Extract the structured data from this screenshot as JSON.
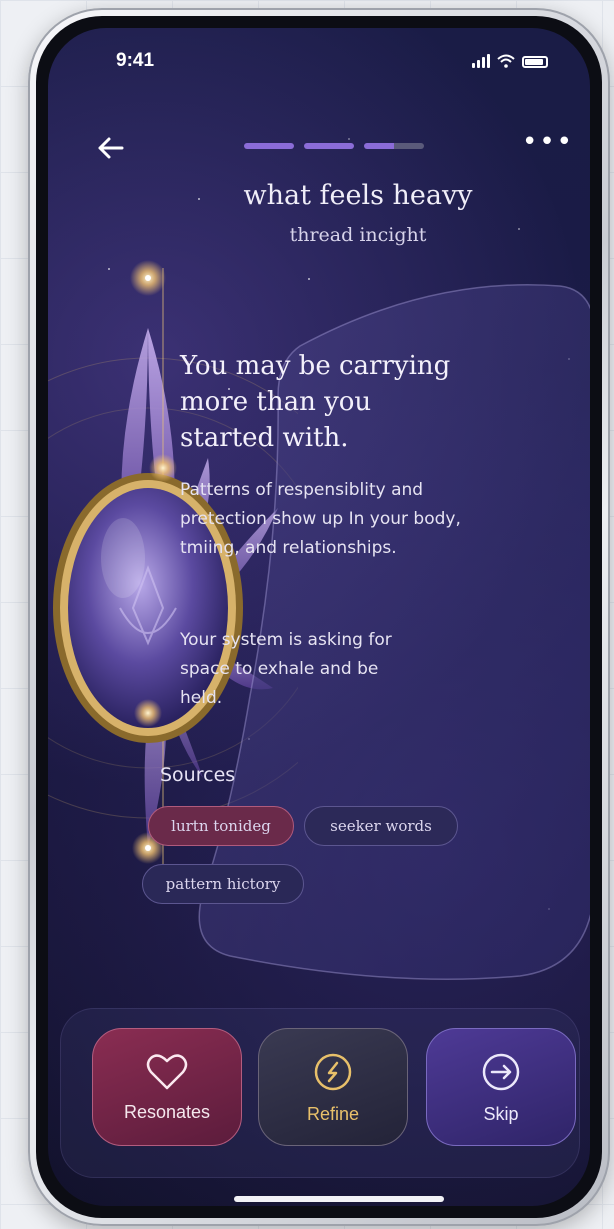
{
  "status_bar": {
    "time": "9:41",
    "icons": [
      "signal-icon",
      "wifi-icon",
      "battery-icon"
    ]
  },
  "nav": {
    "back_icon": "arrow-left-icon",
    "more_label": "•••",
    "progress": {
      "segments": 3,
      "completed": 2.5
    }
  },
  "header": {
    "title": "what feels heavy",
    "subtitle": "thread incight"
  },
  "insight": {
    "heading": "You may be carrying more than you started with.",
    "body_1": "Patterns of respensiblity and pretection show up In your body, tmiing, and relationships.",
    "body_2": "Your system is asking for space to exhale and be held."
  },
  "sources": {
    "label": "Sources",
    "chips": [
      "lurtn tonideg",
      "seeker words",
      "pattern hictory"
    ]
  },
  "actions": {
    "resonates": {
      "label": "Resonates",
      "icon": "heart-icon"
    },
    "refine": {
      "label": "Refine",
      "icon": "refine-icon"
    },
    "skip": {
      "label": "Skip",
      "icon": "arrow-right-circle-icon"
    }
  },
  "colors": {
    "accent_purple": "#8b6cd8",
    "resonates": "#8a2d52",
    "refine_gold": "#e8c06a",
    "skip": "#4e3a96",
    "background": "#1a1c46"
  }
}
